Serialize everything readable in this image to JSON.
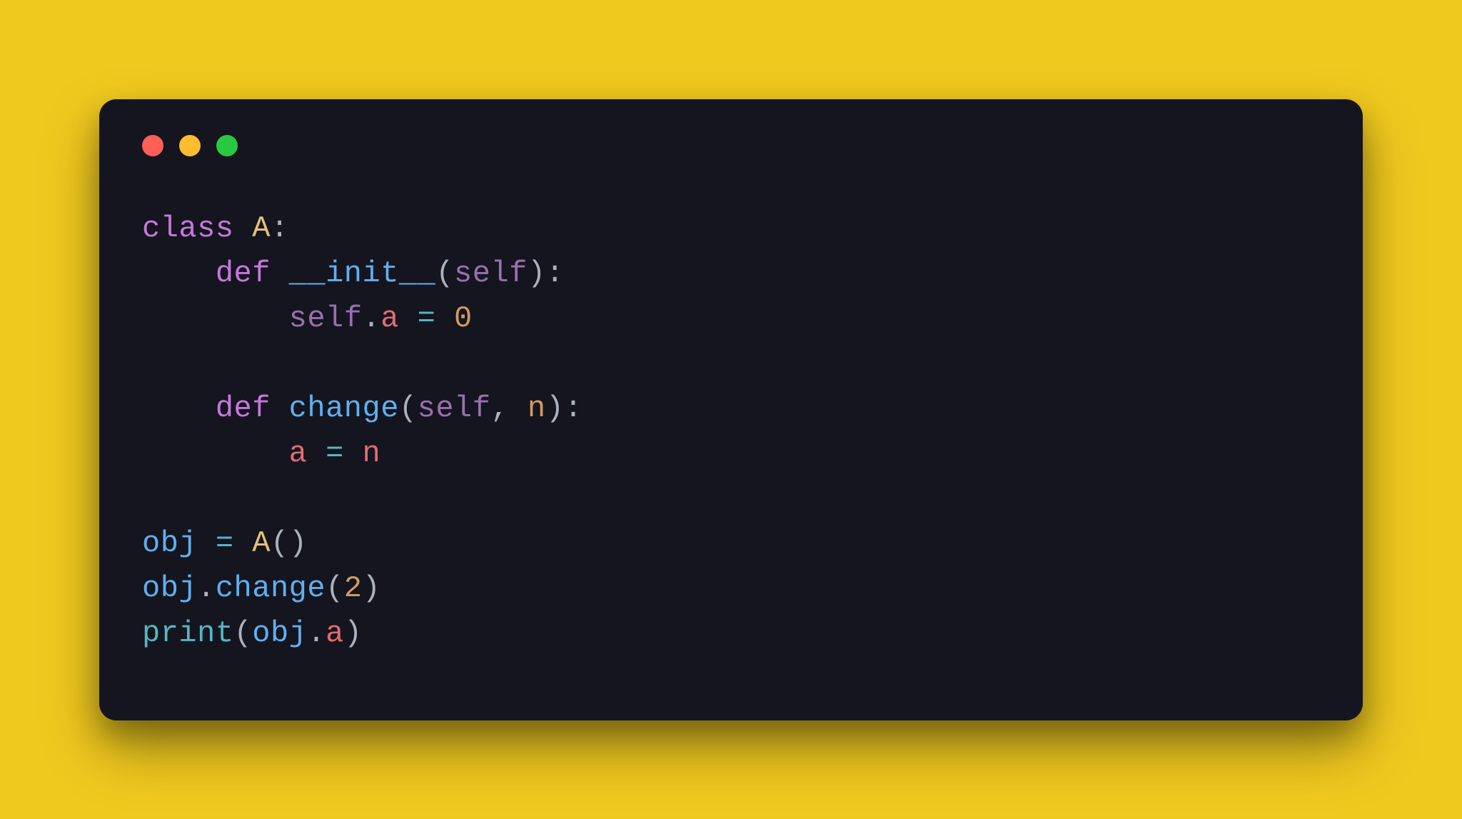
{
  "code": {
    "tokens": {
      "class_kw": "class",
      "class_name": "A",
      "colon": ":",
      "def_kw": "def",
      "init_name": "__init__",
      "lparen": "(",
      "rparen": ")",
      "self_kw": "self",
      "dot": ".",
      "attr_a": "a",
      "assign": " = ",
      "zero": "0",
      "change_name": "change",
      "comma": ", ",
      "param_n": "n",
      "local_a": "a",
      "var_n": "n",
      "obj": "obj",
      "call_args_2": "2",
      "print": "print",
      "empty": ""
    },
    "indent1": "    ",
    "indent2": "        "
  }
}
